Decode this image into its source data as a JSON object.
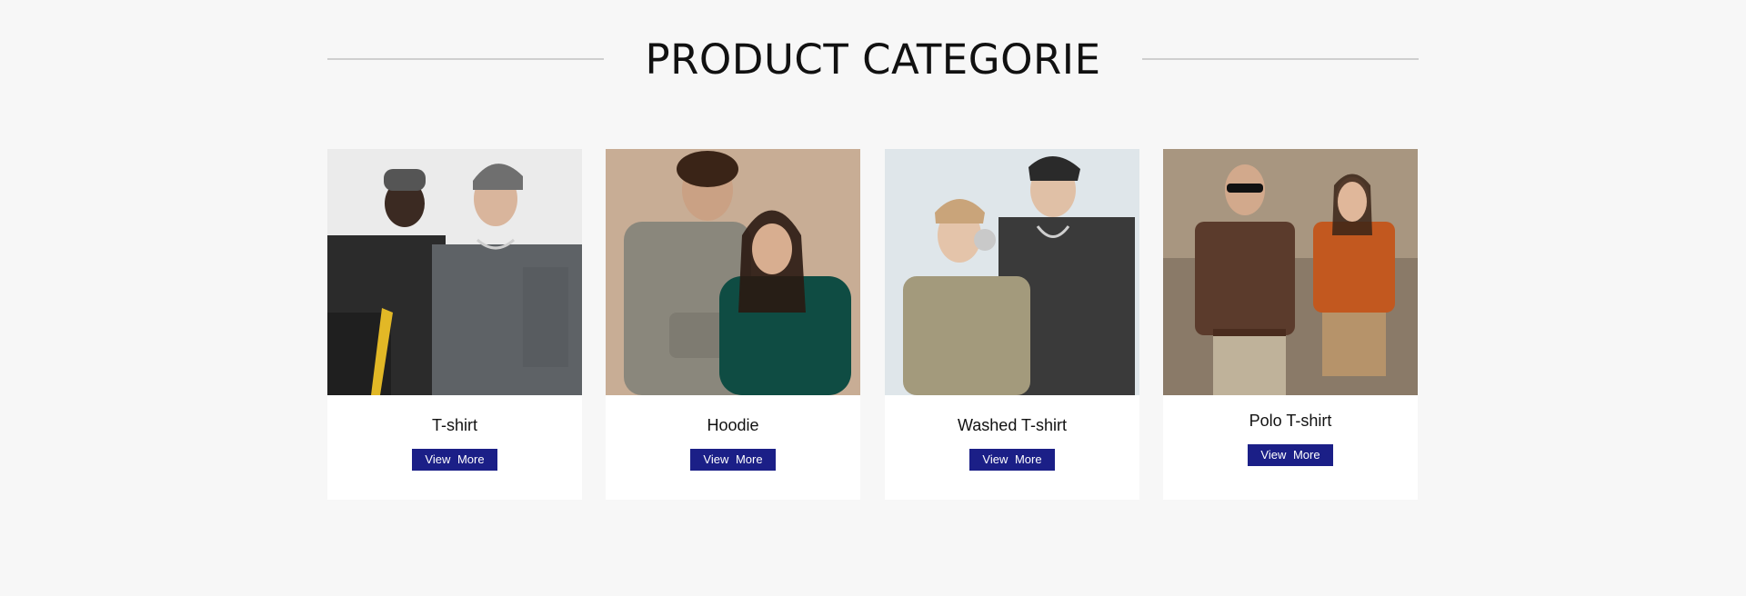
{
  "section": {
    "title": "PRODUCT CATEGORIE"
  },
  "categories": [
    {
      "name": "T-shirt",
      "button_label": "View  More",
      "image_desc": "tshirt-photo"
    },
    {
      "name": "Hoodie",
      "button_label": "View  More",
      "image_desc": "hoodie-photo"
    },
    {
      "name": "Washed T-shirt",
      "button_label": "View  More",
      "image_desc": "washed-tshirt-photo"
    },
    {
      "name": "Polo T-shirt",
      "button_label": "View  More",
      "image_desc": "polo-tshirt-photo"
    }
  ],
  "colors": {
    "background": "#f7f7f7",
    "button": "#1b1f87",
    "divider": "#cfcfcf"
  }
}
